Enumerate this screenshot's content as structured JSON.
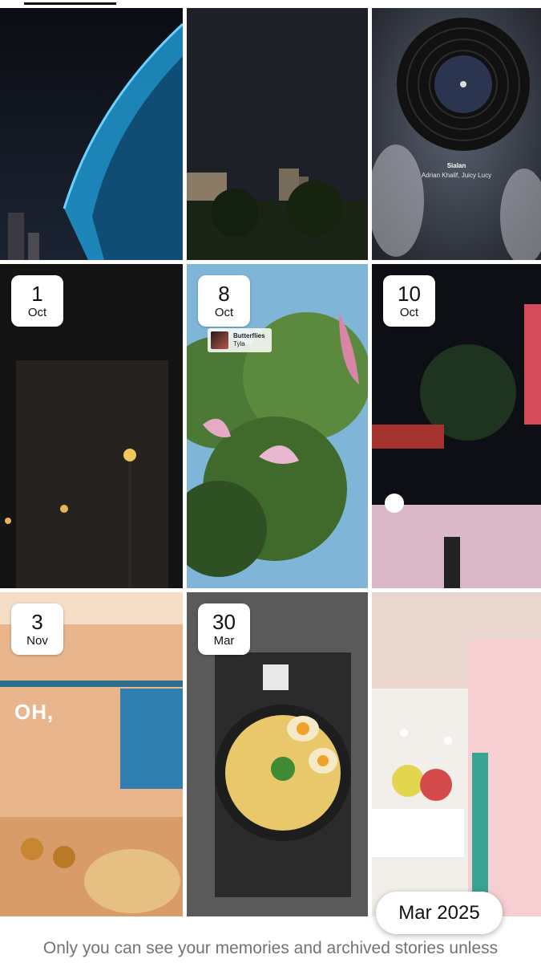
{
  "tiles": [
    {
      "kind": "photo",
      "date": null
    },
    {
      "kind": "photo",
      "date": null
    },
    {
      "kind": "music",
      "date": null,
      "music_title": "Sialan",
      "music_artist": "Adrian Khalif, Juicy Lucy"
    },
    {
      "kind": "photo",
      "date": {
        "day": "1",
        "month": "Oct"
      }
    },
    {
      "kind": "photo",
      "date": {
        "day": "8",
        "month": "Oct"
      },
      "music_title": "Butterflies",
      "music_artist": "Tyla"
    },
    {
      "kind": "photo",
      "date": {
        "day": "10",
        "month": "Oct"
      }
    },
    {
      "kind": "photo",
      "date": {
        "day": "3",
        "month": "Nov"
      },
      "overlay_text": "OH,"
    },
    {
      "kind": "photo",
      "date": {
        "day": "30",
        "month": "Mar"
      }
    },
    {
      "kind": "photo",
      "date": null
    }
  ],
  "month_indicator": "Mar 2025",
  "footer_text": "Only you can see your memories and archived stories unless"
}
